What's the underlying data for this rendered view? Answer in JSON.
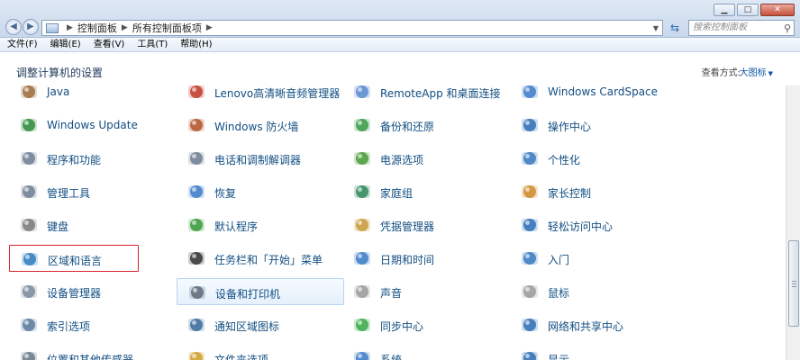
{
  "window": {
    "address": {
      "crumbs": [
        "控制面板",
        "所有控制面板项"
      ]
    },
    "search_placeholder": "搜索控制面板",
    "controls": {
      "minimize": "▭",
      "maximize": "□",
      "close": "✕"
    }
  },
  "menu": [
    "文件(F)",
    "编辑(E)",
    "查看(V)",
    "工具(T)",
    "帮助(H)"
  ],
  "header": {
    "title": "调整计算机的设置",
    "view_by_label": "查看方式:",
    "view_by_value": "大图标"
  },
  "items": [
    [
      "Java",
      "Lenovo高清晰音频管理器",
      "RemoteApp 和桌面连接",
      "Windows CardSpace"
    ],
    [
      "Windows Update",
      "Windows 防火墙",
      "备份和还原",
      "操作中心"
    ],
    [
      "程序和功能",
      "电话和调制解调器",
      "电源选项",
      "个性化"
    ],
    [
      "管理工具",
      "恢复",
      "家庭组",
      "家长控制"
    ],
    [
      "键盘",
      "默认程序",
      "凭据管理器",
      "轻松访问中心"
    ],
    [
      "区域和语言",
      "任务栏和「开始」菜单",
      "日期和时间",
      "入门"
    ],
    [
      "设备管理器",
      "设备和打印机",
      "声音",
      "鼠标"
    ],
    [
      "索引选项",
      "通知区域图标",
      "同步中心",
      "网络和共享中心"
    ],
    [
      "位置和其他传感器",
      "文件夹选项",
      "系统",
      "显示"
    ]
  ],
  "colors": {
    "link": "#124e82",
    "highlight_border": "#d9232e"
  }
}
